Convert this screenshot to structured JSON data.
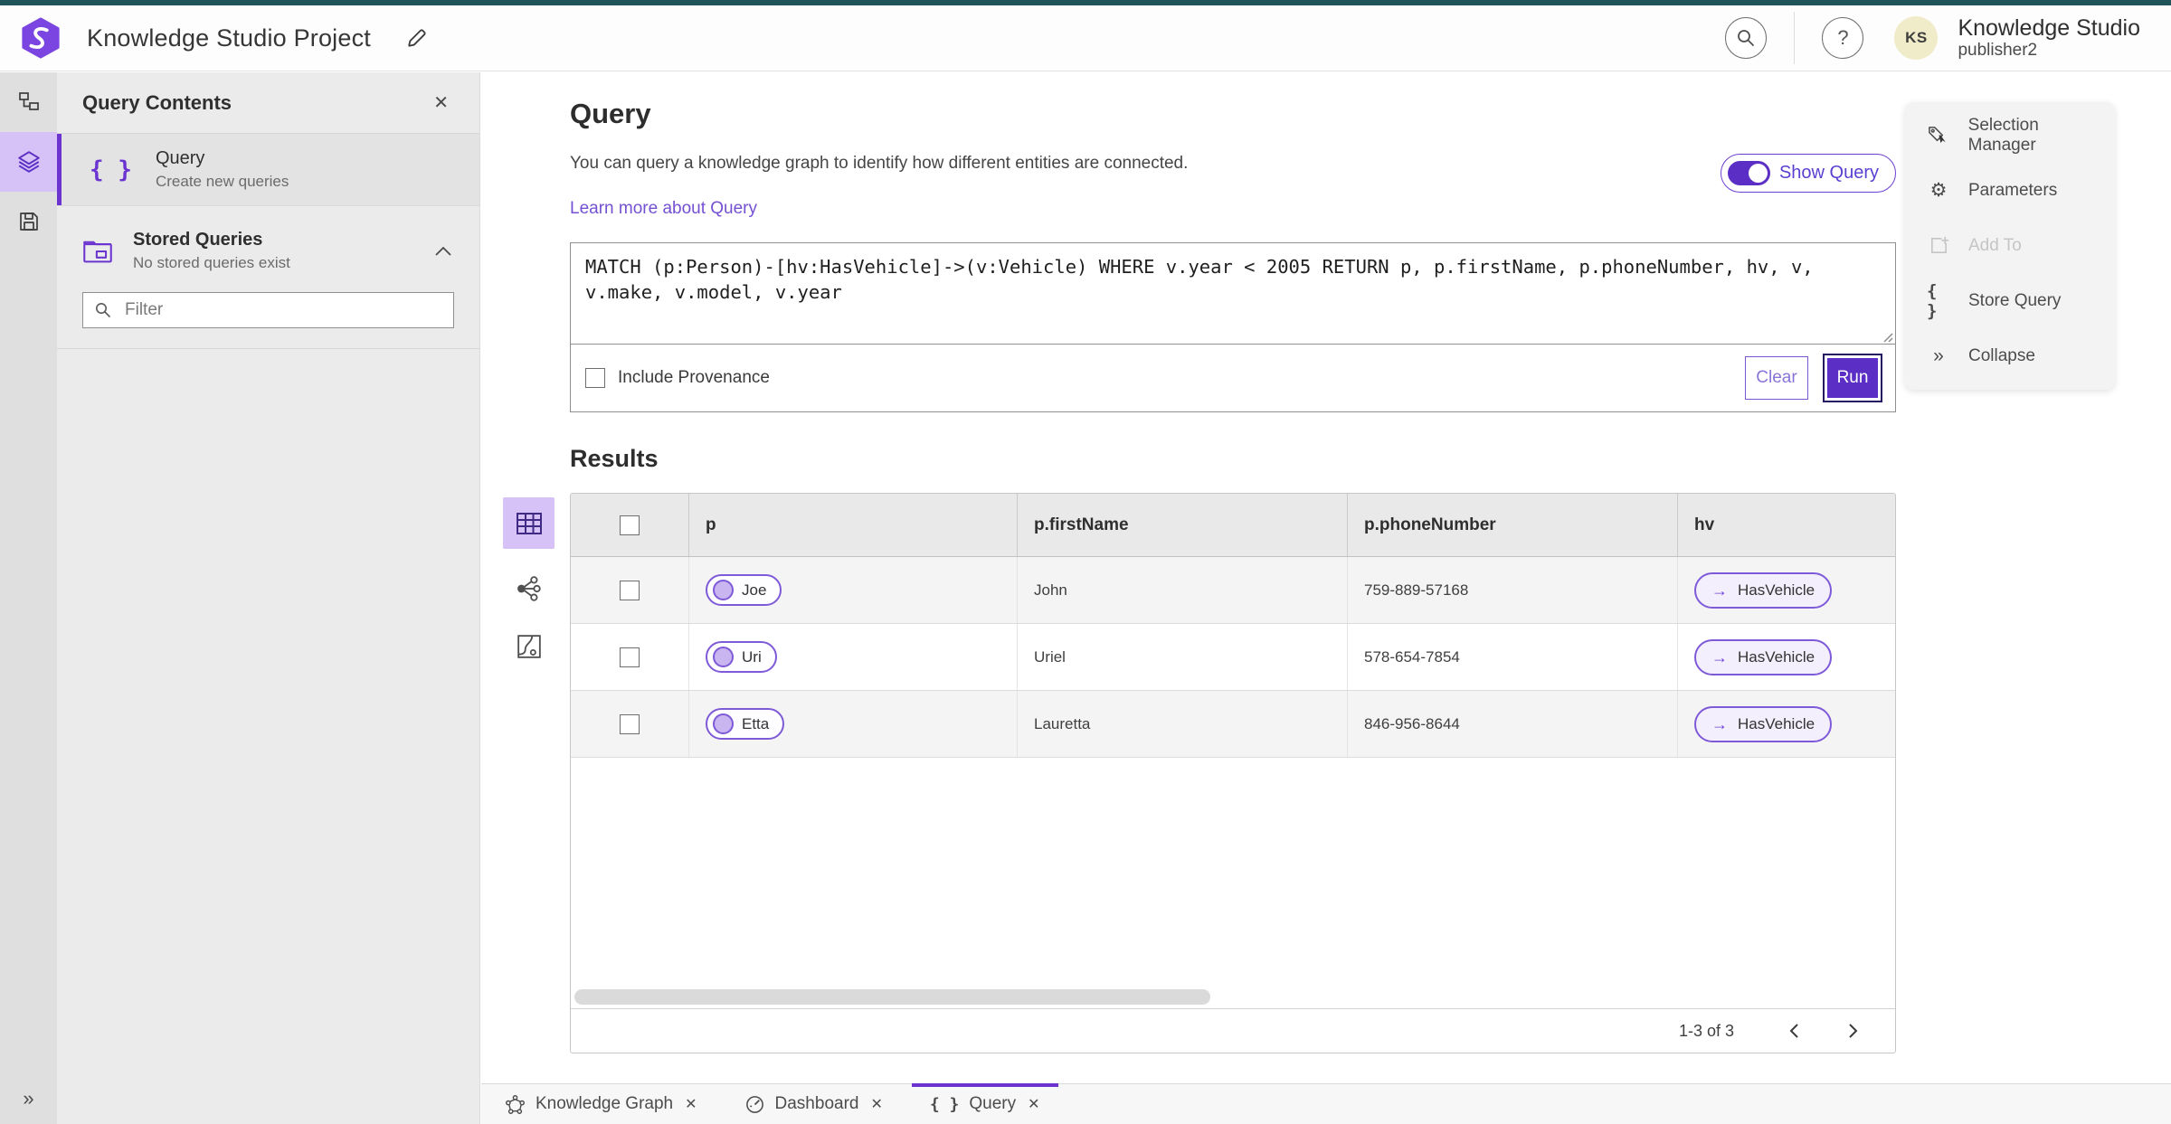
{
  "colors": {
    "accent": "#6b34d1",
    "accent_fill": "#5b2ec5",
    "accent_light": "#d6c2f7",
    "teal_strip": "#1f545a",
    "avatar_bg": "#f0ecca"
  },
  "icons": {
    "braces_glyph": "{ }",
    "close_glyph": "✕",
    "collapse_glyph": "»",
    "expand_glyph": "»",
    "arrow_right_glyph": "→",
    "help_glyph": "?",
    "gear_glyph": "⚙"
  },
  "header": {
    "project_title": "Knowledge Studio Project",
    "product_name": "Knowledge Studio",
    "user_name": "publisher2",
    "avatar_initials": "KS"
  },
  "query_contents": {
    "title": "Query Contents",
    "query_item": {
      "title": "Query",
      "subtitle": "Create new queries"
    },
    "stored_queries": {
      "title": "Stored Queries",
      "subtitle": "No stored queries exist"
    },
    "filter_placeholder": "Filter"
  },
  "query_panel": {
    "title": "Query",
    "description": "You can query a knowledge graph to identify how different entities are connected.",
    "learn_more": "Learn more about Query",
    "show_query_label": "Show Query",
    "query_text": "MATCH (p:Person)-[hv:HasVehicle]->(v:Vehicle) WHERE v.year < 2005 RETURN p, p.firstName, p.phoneNumber, hv, v, v.make, v.model, v.year",
    "include_provenance_label": "Include Provenance",
    "clear_label": "Clear",
    "run_label": "Run"
  },
  "results": {
    "title": "Results",
    "columns": [
      "p",
      "p.firstName",
      "p.phoneNumber",
      "hv"
    ],
    "rows": [
      {
        "p": "Joe",
        "firstName": "John",
        "phone": "759-889-57168",
        "hv": "HasVehicle"
      },
      {
        "p": "Uri",
        "firstName": "Uriel",
        "phone": "578-654-7854",
        "hv": "HasVehicle"
      },
      {
        "p": "Etta",
        "firstName": "Lauretta",
        "phone": "846-956-8644",
        "hv": "HasVehicle"
      }
    ],
    "pagination": "1-3 of 3"
  },
  "side_menu": {
    "selection_manager": "Selection Manager",
    "parameters": "Parameters",
    "add_to": "Add To",
    "store_query": "Store Query",
    "collapse": "Collapse"
  },
  "tabs": [
    {
      "label": "Knowledge Graph"
    },
    {
      "label": "Dashboard"
    },
    {
      "label": "Query"
    }
  ]
}
